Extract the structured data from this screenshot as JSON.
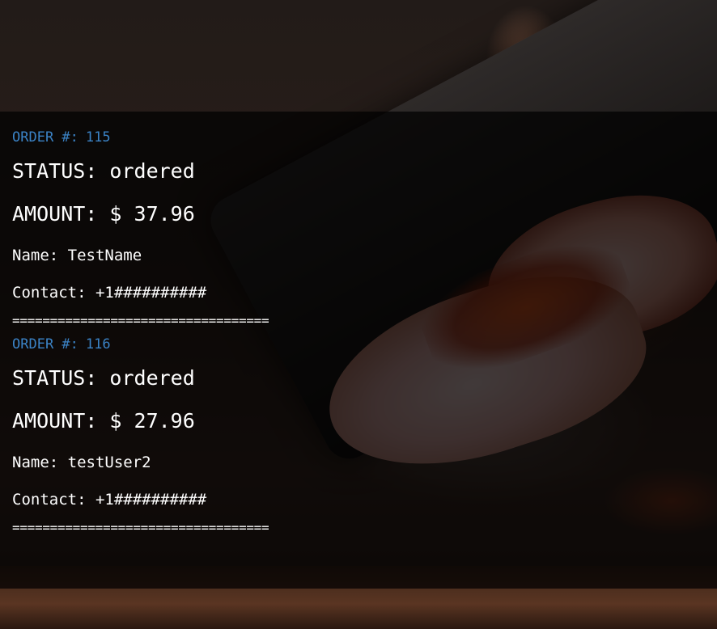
{
  "orders": [
    {
      "order_label": "ORDER #:",
      "order_number": "115",
      "status_label": "STATUS:",
      "status": "ordered",
      "amount_label": "AMOUNT:",
      "amount": "$ 37.96",
      "name_label": "Name:",
      "name": "TestName",
      "contact_label": "Contact:",
      "contact": "+1##########",
      "separator": "=================================="
    },
    {
      "order_label": "ORDER #:",
      "order_number": "116",
      "status_label": "STATUS:",
      "status": "ordered",
      "amount_label": "AMOUNT:",
      "amount": "$ 27.96",
      "name_label": "Name:",
      "name": "testUser2",
      "contact_label": "Contact:",
      "contact": "+1##########",
      "separator": "=================================="
    }
  ],
  "colors": {
    "order_number": "#3b83c6",
    "text": "#ffffff",
    "overlay": "rgba(0,0,0,0.72)"
  }
}
